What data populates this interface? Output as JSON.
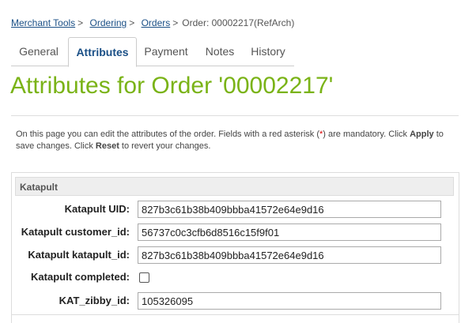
{
  "breadcrumb": {
    "items": [
      "Merchant Tools",
      "Ordering",
      "Orders"
    ],
    "current": "Order: 00002217(RefArch)",
    "separator": ">"
  },
  "tabs": [
    {
      "label": "General"
    },
    {
      "label": "Attributes",
      "active": true
    },
    {
      "label": "Payment"
    },
    {
      "label": "Notes"
    },
    {
      "label": "History"
    }
  ],
  "title": "Attributes for Order '00002217'",
  "description": {
    "part1": "On this page you can edit the attributes of the order. Fields with a red asterisk (",
    "asterisk": "*",
    "part2": ") are mandatory. Click ",
    "apply": "Apply",
    "part3": " to save changes. Click ",
    "reset": "Reset",
    "part4": " to revert your changes."
  },
  "group": {
    "title": "Katapult",
    "fields": [
      {
        "label": "Katapult UID:",
        "value": "827b3c61b38b409bbba41572e64e9d16"
      },
      {
        "label": "Katapult customer_id:",
        "value": "56737c0c3cfb6d8516c15f9f01"
      },
      {
        "label": "Katapult katapult_id:",
        "value": "827b3c61b38b409bbba41572e64e9d16"
      },
      {
        "label": "Katapult completed:",
        "checked": false
      },
      {
        "label": "KAT_zibby_id:",
        "value": "105326095"
      }
    ]
  },
  "colors": {
    "title": "#7ab317",
    "link": "#1a4f86"
  }
}
